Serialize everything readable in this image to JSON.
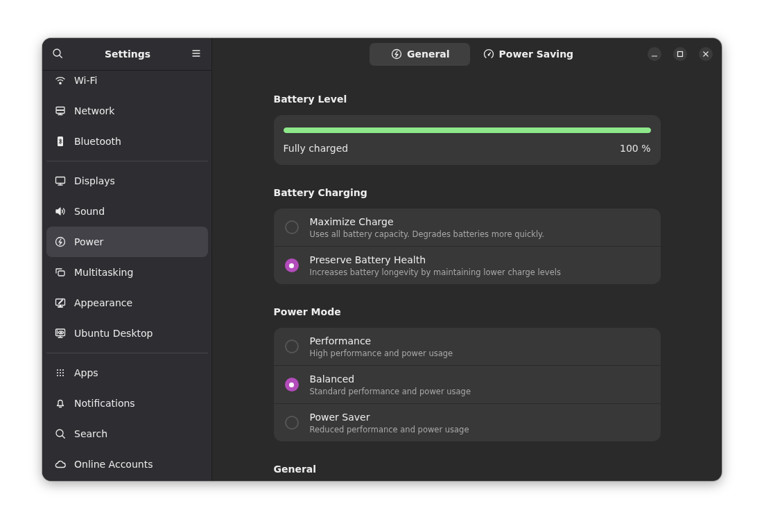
{
  "sidebar": {
    "title": "Settings",
    "groups": [
      {
        "items": [
          {
            "label": "Wi-Fi",
            "selected": false
          },
          {
            "label": "Network",
            "selected": false
          },
          {
            "label": "Bluetooth",
            "selected": false
          }
        ]
      },
      {
        "items": [
          {
            "label": "Displays",
            "selected": false
          },
          {
            "label": "Sound",
            "selected": false
          },
          {
            "label": "Power",
            "selected": true
          },
          {
            "label": "Multitasking",
            "selected": false
          },
          {
            "label": "Appearance",
            "selected": false
          },
          {
            "label": "Ubuntu Desktop",
            "selected": false
          }
        ]
      },
      {
        "items": [
          {
            "label": "Apps",
            "selected": false
          },
          {
            "label": "Notifications",
            "selected": false
          },
          {
            "label": "Search",
            "selected": false
          },
          {
            "label": "Online Accounts",
            "selected": false
          }
        ]
      }
    ]
  },
  "tabs": [
    {
      "label": "General",
      "selected": true
    },
    {
      "label": "Power Saving",
      "selected": false
    }
  ],
  "sections": [
    {
      "title": "Battery Level",
      "kind": "level",
      "level": 1,
      "status": "Fully charged",
      "reading": "100 %"
    },
    {
      "title": "Battery Charging",
      "kind": "options",
      "options": [
        {
          "label": "Maximize Charge",
          "description": "Uses all battery capacity. Degrades batteries more quickly.",
          "selected": false
        },
        {
          "label": "Preserve Battery Health",
          "description": "Increases battery longevity by maintaining lower charge levels",
          "selected": true
        }
      ]
    },
    {
      "title": "Power Mode",
      "kind": "options",
      "options": [
        {
          "label": "Performance",
          "description": "High performance and power usage",
          "selected": false
        },
        {
          "label": "Balanced",
          "description": "Standard performance and power usage",
          "selected": true
        },
        {
          "label": "Power Saver",
          "description": "Reduced performance and power usage",
          "selected": false
        }
      ]
    },
    {
      "title": "General",
      "kind": "heading"
    }
  ]
}
